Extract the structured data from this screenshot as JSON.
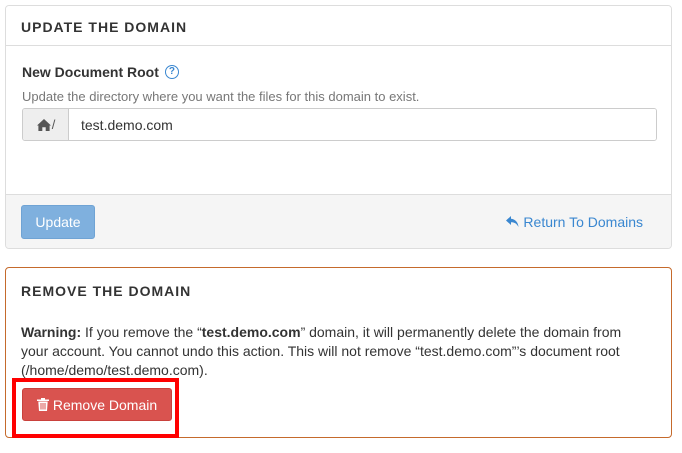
{
  "update_panel": {
    "title": "UPDATE THE DOMAIN",
    "field_label": "New Document Root",
    "field_help_icon": "question-circle-icon",
    "field_description": "Update the directory where you want the files for this domain to exist.",
    "addon_icon": "home-icon",
    "addon_suffix": "/",
    "document_root_value": "test.demo.com",
    "update_button": "Update",
    "return_link": "Return To Domains",
    "return_icon": "reply-arrow-icon"
  },
  "remove_panel": {
    "title": "REMOVE THE DOMAIN",
    "warning_label": "Warning:",
    "warning_pre": " If you remove the “",
    "domain": "test.demo.com",
    "warning_post": "” domain, it will permanently delete the domain from your account. You cannot undo this action. This will not remove “test.demo.com”’s document root (/home/demo/test.demo.com).",
    "remove_button": "Remove Domain",
    "remove_icon": "trash-icon"
  },
  "colors": {
    "primary": "#3a87d0",
    "update_button_bg": "#7fb0de",
    "danger": "#d9534f",
    "remove_panel_border": "#c56a2c",
    "highlight": "#ff0000"
  }
}
